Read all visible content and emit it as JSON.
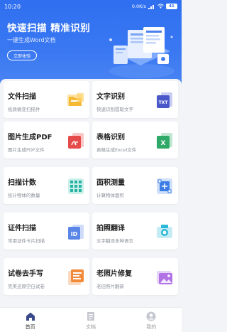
{
  "status_bar": {
    "time": "10:20",
    "network_speed": "0.0K/s",
    "battery": "41"
  },
  "hero": {
    "title": "快速扫描 精准识别",
    "subtitle": "一键生成Word文档",
    "button_label": "立即体验",
    "accent_color": "#2f6ff0"
  },
  "cards": [
    {
      "title": "文件扫描",
      "desc": "纸质稿变扫描件",
      "icon": "folder-scan-icon",
      "color": "#f5b935"
    },
    {
      "title": "文字识别",
      "desc": "快速识别提取文字",
      "icon": "txt-document-icon",
      "color": "#4a57c8"
    },
    {
      "title": "图片生成PDF",
      "desc": "图片生成PDF文件",
      "icon": "pdf-document-icon",
      "color": "#e64b4b"
    },
    {
      "title": "表格识别",
      "desc": "表格生成Excel文件",
      "icon": "excel-document-icon",
      "color": "#2fa968"
    },
    {
      "title": "扫描计数",
      "desc": "统计物体的数量",
      "icon": "count-grid-icon",
      "color": "#27b2a4"
    },
    {
      "title": "面积测量",
      "desc": "计算物体面积",
      "icon": "area-measure-icon",
      "color": "#3c7de6"
    },
    {
      "title": "证件扫描",
      "desc": "常用证件卡片扫描",
      "icon": "id-card-icon",
      "color": "#5a86e8"
    },
    {
      "title": "拍照翻译",
      "desc": "文字翻译多种语言",
      "icon": "camera-translate-icon",
      "color": "#2bb7d6"
    },
    {
      "title": "试卷去手写",
      "desc": "完美还原空白试卷",
      "icon": "exam-paper-icon",
      "color": "#f28a3c"
    },
    {
      "title": "老照片修复",
      "desc": "老旧照片翻新",
      "icon": "photo-restore-icon",
      "color": "#b172e6"
    }
  ],
  "tabbar": [
    {
      "label": "首页",
      "icon": "home-icon",
      "active": true
    },
    {
      "label": "文档",
      "icon": "document-icon",
      "active": false
    },
    {
      "label": "我的",
      "icon": "user-icon",
      "active": false
    }
  ]
}
